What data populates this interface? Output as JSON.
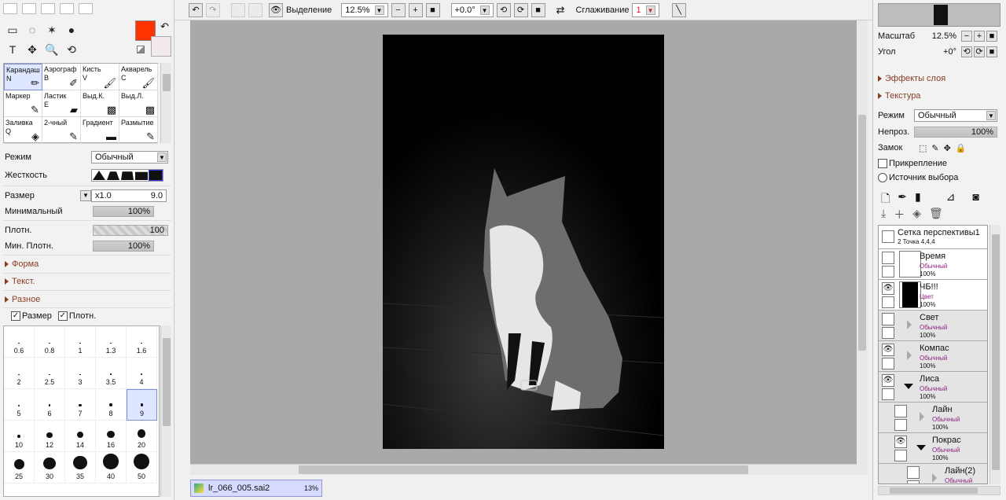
{
  "toolbar": {
    "selection_label": "Выделение",
    "zoom": "12.5%",
    "rotation": "+0.0°",
    "smoothing_label": "Сглаживание",
    "smoothing_value": "1"
  },
  "colors": {
    "primary": "#ff3300",
    "secondary": "#f1e9ec",
    "canvas_bg": "#a9a9a9",
    "selected_bg": "#dfe6ff",
    "section_text": "#8a3d23",
    "blend_text": "#8d1f7d"
  },
  "tools": {
    "grid_icons": [
      "▭",
      "◌",
      "✶",
      "●",
      "T",
      "✥",
      "🔍",
      "⟲",
      "✋",
      "✎"
    ]
  },
  "brushes": [
    {
      "name": "Карандаш",
      "key": "N",
      "icon": "✏"
    },
    {
      "name": "Аэрограф",
      "key": "B",
      "icon": "✐"
    },
    {
      "name": "Кисть",
      "key": "V",
      "icon": "🖌"
    },
    {
      "name": "Акварель",
      "key": "C",
      "icon": "🖌"
    },
    {
      "name": "Маркер",
      "key": "",
      "icon": "✎"
    },
    {
      "name": "Ластик",
      "key": "E",
      "icon": "▰"
    },
    {
      "name": "Выд.К.",
      "key": "",
      "icon": "▩"
    },
    {
      "name": "Выд.Л.",
      "key": "",
      "icon": "▩"
    },
    {
      "name": "Заливка",
      "key": "Q",
      "icon": "◈"
    },
    {
      "name": "2-чный",
      "key": "",
      "icon": "✎"
    },
    {
      "name": "Градиент",
      "key": "",
      "icon": "▬"
    },
    {
      "name": "Размытие",
      "key": "",
      "icon": "✎"
    }
  ],
  "brush_settings": {
    "mode_label": "Режим",
    "mode_value": "Обычный",
    "hardness_label": "Жесткость",
    "size_label": "Размер",
    "size_mult": "x1.0",
    "size_value": "9.0",
    "min_label": "Минимальный",
    "min_value": "100%",
    "density_label": "Плотн.",
    "density_value": "100",
    "min_density_label": "Мин. Плотн.",
    "min_density_value": "100%",
    "section_shape": "Форма",
    "section_texture": "Текст.",
    "section_misc": "Разное",
    "check_size": "Размер",
    "check_density": "Плотн."
  },
  "sizes": [
    "0.6",
    "0.8",
    "1",
    "1.3",
    "1.6",
    "2",
    "2.5",
    "3",
    "3.5",
    "4",
    "5",
    "6",
    "7",
    "8",
    "9",
    "10",
    "12",
    "14",
    "16",
    "20",
    "25",
    "30",
    "35",
    "40",
    "50"
  ],
  "file_tab": {
    "name": "lr_066_005.sai2",
    "zoom": "13%"
  },
  "right": {
    "scale_label": "Масштаб",
    "scale_value": "12.5%",
    "angle_label": "Угол",
    "angle_value": "+0°",
    "layer_effects": "Эффекты слоя",
    "texture": "Текстура",
    "mode_label": "Режим",
    "mode_value": "Обычный",
    "opacity_label": "Непроз.",
    "opacity_value": "100%",
    "lock_label": "Замок",
    "clip_label": "Прикрепление",
    "source_label": "Источник выбора"
  },
  "layers": [
    {
      "name": "Сетка перспективы1",
      "mode": "2 Точка 4,4,4",
      "opacity": "",
      "type": "persp"
    },
    {
      "name": "Время",
      "mode": "Обычный",
      "opacity": "100%",
      "type": "white"
    },
    {
      "name": "ЧБ!!!",
      "mode": "Цвет",
      "opacity": "100%",
      "type": "black",
      "eye": true
    },
    {
      "name": "Свет",
      "mode": "Обычный",
      "opacity": "100%",
      "type": "folder"
    },
    {
      "name": "Компас",
      "mode": "Обычный",
      "opacity": "100%",
      "type": "folder",
      "eye": true
    },
    {
      "name": "Лиса",
      "mode": "Обычный",
      "opacity": "100%",
      "type": "folder-open",
      "eye": true
    },
    {
      "name": "Лайн",
      "mode": "Обычный",
      "opacity": "100%",
      "type": "folder",
      "indent": 1
    },
    {
      "name": "Покрас",
      "mode": "Обычный",
      "opacity": "100%",
      "type": "folder-open",
      "eye": true,
      "indent": 1
    },
    {
      "name": "Лайн(2)",
      "mode": "Обычный",
      "opacity": "",
      "type": "folder",
      "indent": 2
    }
  ]
}
